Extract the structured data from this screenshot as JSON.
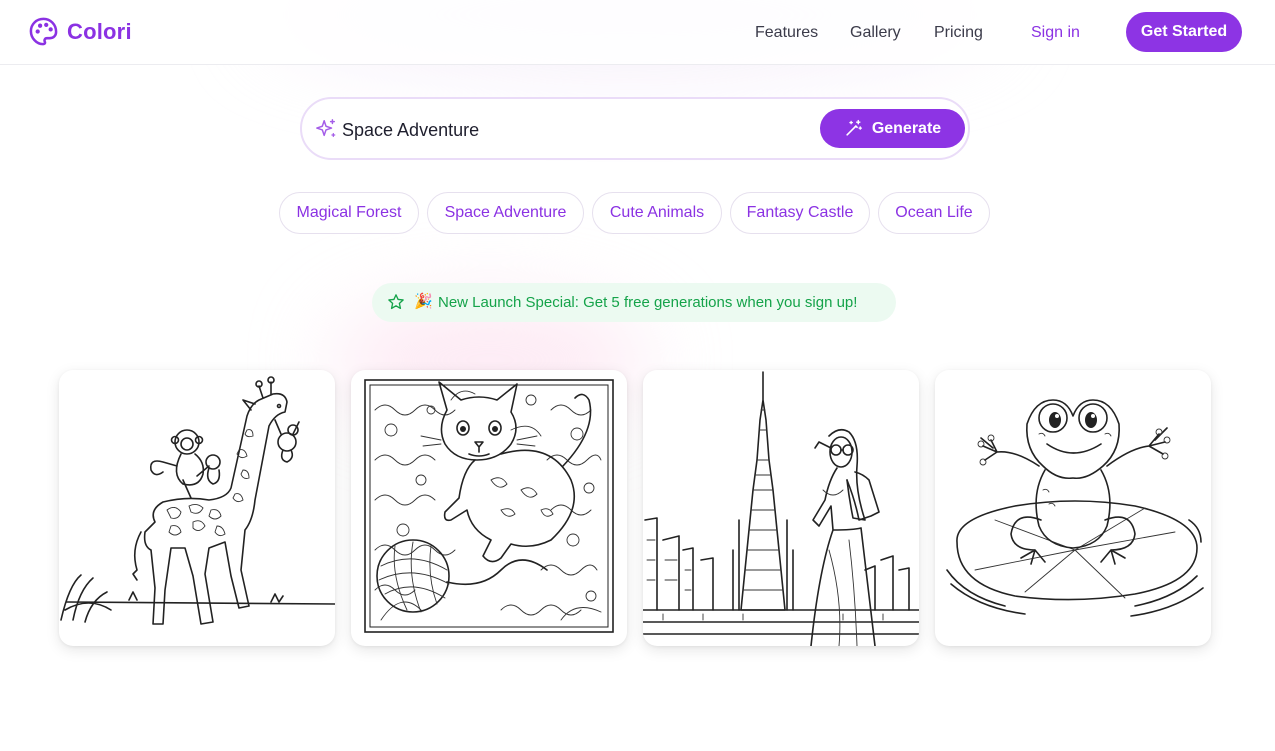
{
  "brand": {
    "name": "Colori",
    "accent_color": "#8d34e4",
    "logo_icon": "palette-icon"
  },
  "nav": {
    "links": [
      "Features",
      "Gallery",
      "Pricing"
    ],
    "sign_in": "Sign in",
    "cta": "Get Started"
  },
  "search": {
    "icon": "sparkle-icon",
    "value": "Space Adventure",
    "placeholder": "Space Adventure",
    "button_icon": "magic-wand-icon",
    "button_label": "Generate"
  },
  "suggestions": [
    "Magical Forest",
    "Space Adventure",
    "Cute Animals",
    "Fantasy Castle",
    "Ocean Life"
  ],
  "promo": {
    "icon": "star-icon",
    "emoji": "🎉",
    "text": "New Launch Special: Get 5 free generations when you sign up!",
    "color": "#15a34a"
  },
  "gallery": {
    "items": [
      {
        "subject": "giraffe-with-monkeys"
      },
      {
        "subject": "kitten-with-yarn-ball"
      },
      {
        "subject": "woman-at-skyscraper"
      },
      {
        "subject": "frog-on-lily-pad"
      }
    ]
  }
}
